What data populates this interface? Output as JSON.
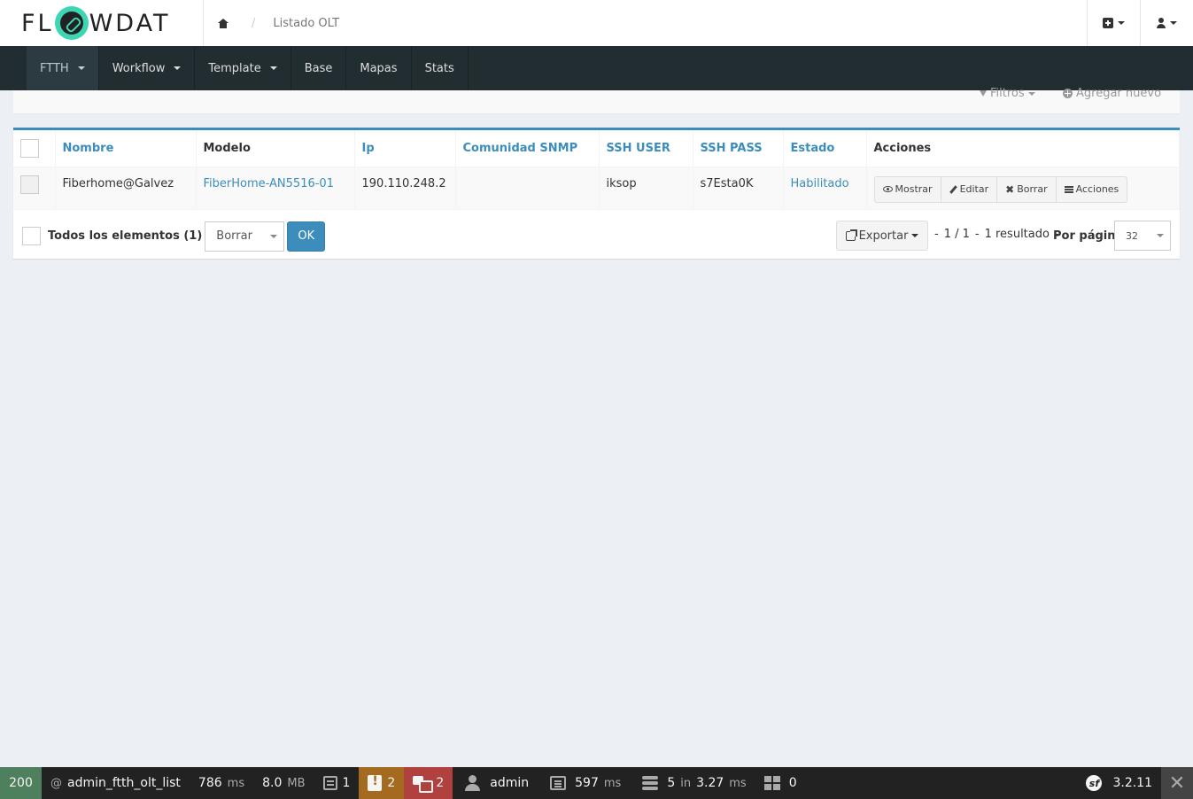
{
  "header": {
    "logo_text_left": "FL",
    "logo_text_right": "WDAT",
    "breadcrumb_sep": "/",
    "breadcrumb_current": "Listado OLT"
  },
  "nav": {
    "items": [
      {
        "label": "FTTH"
      },
      {
        "label": "Workflow"
      },
      {
        "label": "Template"
      },
      {
        "label": "Base"
      },
      {
        "label": "Mapas"
      },
      {
        "label": "Stats"
      }
    ]
  },
  "filters": {
    "filters_label": "Filtros",
    "add_new_label": "Agregar nuevo"
  },
  "table": {
    "headers": [
      "Nombre",
      "Modelo",
      "Ip",
      "Comunidad SNMP",
      "SSH USER",
      "SSH PASS",
      "Estado",
      "Acciones"
    ],
    "rows": [
      {
        "nombre": "Fiberhome@Galvez",
        "modelo": "FiberHome-AN5516-01",
        "ip": "190.110.248.2",
        "comunidad": "",
        "ssh_user": "iksop",
        "ssh_pass": "s7Esta0K",
        "estado": "Habilitado"
      }
    ],
    "actions": {
      "show": "Mostrar",
      "edit": "Editar",
      "delete": "Borrar",
      "more": "Acciones"
    }
  },
  "batch": {
    "all_label": "Todos los elementos (1)",
    "action_value": "Borrar",
    "ok_label": "OK",
    "export_label": "Exportar",
    "pager_sep": "-",
    "pages": "1 / 1",
    "results": "1 resultado",
    "per_page_label": "Por página",
    "per_page_value": "32"
  },
  "debug_toolbar": {
    "status": "200",
    "route_prefix": "@",
    "route": "admin_ftth_olt_list",
    "time_value": "786",
    "time_unit": "ms",
    "memory_value": "8.0",
    "memory_unit": "MB",
    "logs_count": "1",
    "warnings_count": "2",
    "translations_count": "2",
    "user": "admin",
    "render_value": "597",
    "render_unit": "ms",
    "db_queries": "5",
    "db_in": "in",
    "db_time": "3.27",
    "db_unit": "ms",
    "forms_count": "0",
    "symfony_version": "3.2.11"
  }
}
